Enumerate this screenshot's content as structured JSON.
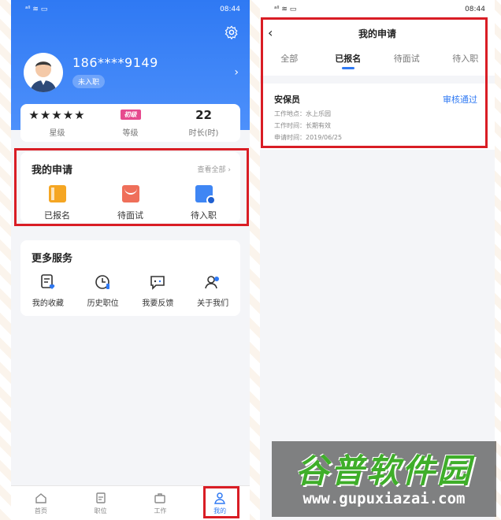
{
  "left": {
    "status_time": "08:44",
    "profile": {
      "phone": "186****9149",
      "tag": "未入职"
    },
    "stats": [
      {
        "label": "星级"
      },
      {
        "value_badge": "初级",
        "label": "等级"
      },
      {
        "value": "22",
        "label": "时长(时)"
      }
    ],
    "applications": {
      "title": "我的申请",
      "view_all": "查看全部",
      "items": [
        {
          "label": "已报名",
          "icon": "notebook-icon"
        },
        {
          "label": "待面试",
          "icon": "envelope-icon"
        },
        {
          "label": "待入职",
          "icon": "id-card-clock-icon"
        }
      ]
    },
    "more_services": {
      "title": "更多服务",
      "items": [
        {
          "label": "我的收藏",
          "icon": "favorites-icon"
        },
        {
          "label": "历史职位",
          "icon": "history-icon"
        },
        {
          "label": "我要反馈",
          "icon": "feedback-icon"
        },
        {
          "label": "关于我们",
          "icon": "about-us-icon"
        }
      ]
    },
    "nav": [
      {
        "label": "首页",
        "icon": "home-icon"
      },
      {
        "label": "职位",
        "icon": "jobs-icon"
      },
      {
        "label": "工作",
        "icon": "briefcase-icon"
      },
      {
        "label": "我的",
        "icon": "profile-icon"
      }
    ],
    "accent": "#2f79f3",
    "highlight": "#d91d25"
  },
  "right": {
    "status_time": "08:44",
    "title": "我的申请",
    "tabs": [
      "全部",
      "已报名",
      "待面试",
      "待入职"
    ],
    "active_tab": "已报名",
    "job": {
      "title": "安保员",
      "status": "审核通过",
      "location": "工作地点：水上乐园",
      "work_time": "工作时间：长期有效",
      "apply_time": "申请时间：2019/06/25"
    }
  },
  "watermark": {
    "name": "谷普软件园",
    "url": "www.gupuxiazai.com"
  }
}
